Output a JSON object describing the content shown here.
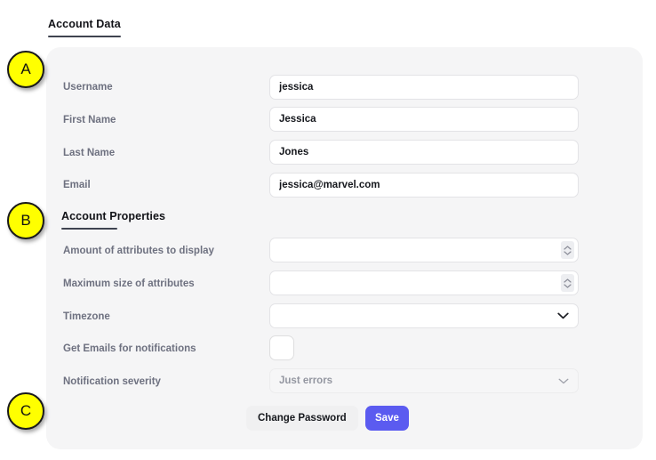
{
  "sections": {
    "account_data": {
      "heading": "Account Data",
      "fields": [
        {
          "label": "Username",
          "value": "jessica",
          "placeholder": ""
        },
        {
          "label": "First Name",
          "value": "Jessica",
          "placeholder": ""
        },
        {
          "label": "Last Name",
          "value": "Jones",
          "placeholder": ""
        },
        {
          "label": "Email",
          "value": "jessica@marvel.com",
          "placeholder": ""
        }
      ]
    },
    "account_properties": {
      "heading": "Account Properties",
      "fields": [
        {
          "label": "Amount of attributes to display",
          "value": "",
          "placeholder": ""
        },
        {
          "label": "Maximum size of attributes",
          "value": "",
          "placeholder": ""
        },
        {
          "label": "Timezone",
          "value": "",
          "placeholder": ""
        },
        {
          "label": "Get Emails for notifications",
          "value": "",
          "placeholder": ""
        },
        {
          "label": "Notification severity",
          "value": "Just errors",
          "placeholder": ""
        }
      ]
    }
  },
  "buttons": {
    "change_password": "Change Password",
    "save": "Save"
  },
  "annotations": [
    {
      "id": "A",
      "label": "A"
    },
    {
      "id": "B",
      "label": "B"
    },
    {
      "id": "C",
      "label": "C"
    }
  ],
  "icons": {
    "spinner_up": "chevron-up-icon",
    "spinner_down": "chevron-down-icon",
    "dropdown": "chevron-down-icon"
  },
  "colors": {
    "accent": "#5b5bf0",
    "card_bg": "#f5f5f6",
    "label": "#6e7180",
    "badge": "#ffff00"
  }
}
